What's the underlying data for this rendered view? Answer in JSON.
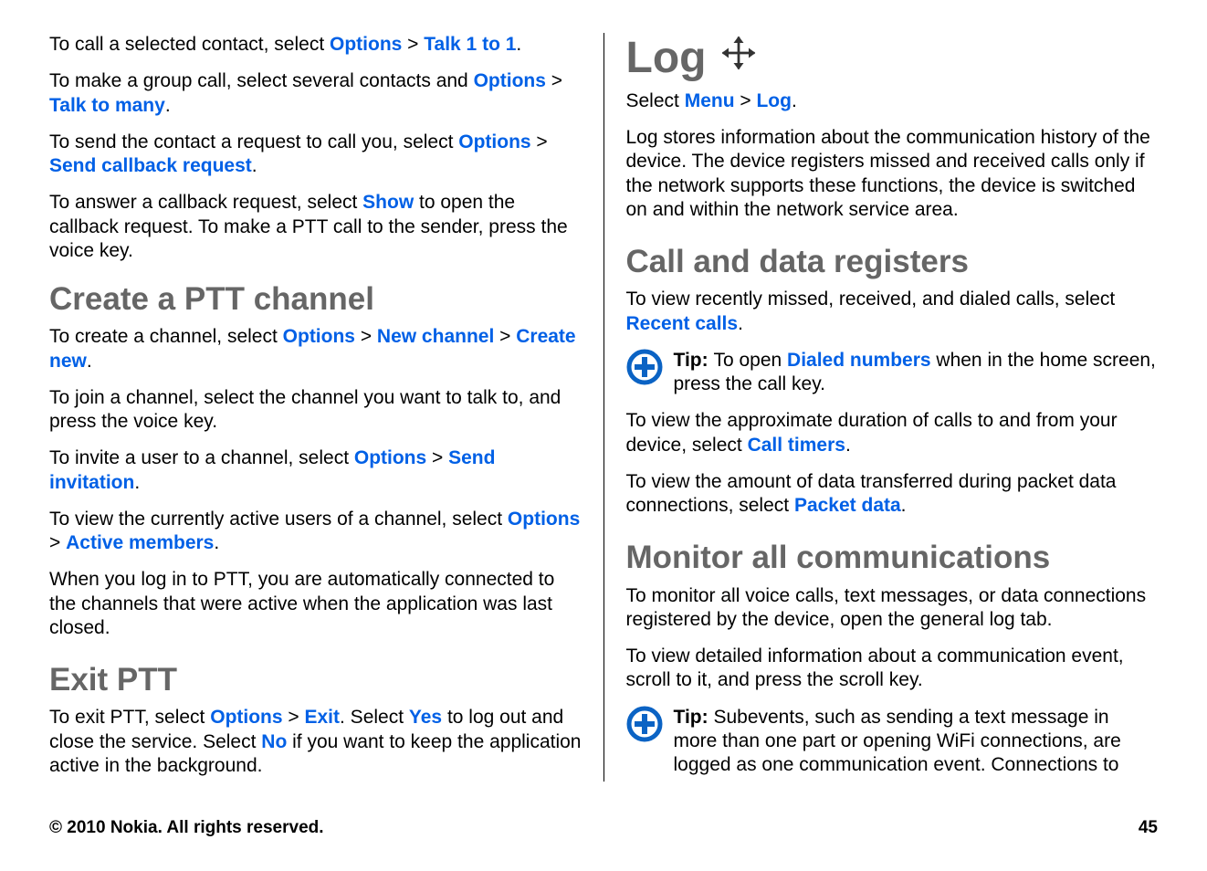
{
  "left": {
    "p1": {
      "t1": "To call a selected contact, select ",
      "options": "Options",
      "sep1": " > ",
      "talk1": "Talk 1 to 1",
      "end": "."
    },
    "p2": {
      "t1": "To make a group call, select several contacts and ",
      "options": "Options",
      "sep1": " > ",
      "talkmany": "Talk to many",
      "end": "."
    },
    "p3": {
      "t1": "To send the contact a request to call you, select ",
      "options": "Options",
      "sep1": " > ",
      "send": "Send callback request",
      "end": "."
    },
    "p4": {
      "t1": "To answer a callback request, select ",
      "show": "Show",
      "t2": " to open the callback request. To make a PTT call to the sender, press the voice key."
    },
    "h_create": "Create a PTT channel",
    "p5": {
      "t1": "To create a channel, select ",
      "options": "Options",
      "sep1": " > ",
      "newch": "New channel",
      "sep2": " > ",
      "create": "Create new",
      "end": "."
    },
    "p6": "To join a channel, select the channel you want to talk to, and press the voice key.",
    "p7": {
      "t1": "To invite a user to a channel, select ",
      "options": "Options",
      "sep1": " > ",
      "sendinv": "Send invitation",
      "end": "."
    },
    "p8": {
      "t1": "To view the currently active users of a channel, select ",
      "options": "Options",
      "sep1": " > ",
      "active": "Active members",
      "end": "."
    },
    "p9": "When you log in to PTT, you are automatically connected to the channels that were active when the application was last closed.",
    "h_exit": "Exit PTT",
    "p10": {
      "t1": "To exit PTT, select ",
      "options": "Options",
      "sep1": " > ",
      "exit": "Exit",
      "t2": ". Select ",
      "yes": "Yes",
      "t3": " to log out and close the service. Select ",
      "no": "No",
      "t4": " if you want to keep the application active in the background."
    }
  },
  "right": {
    "h_log": "Log",
    "p1": {
      "t1": "Select ",
      "menu": "Menu",
      "sep1": " > ",
      "log": "Log",
      "end": "."
    },
    "p2": "Log stores information about the communication history of the device. The device registers missed and received calls only if the network supports these functions, the device is switched on and within the network service area.",
    "h_call": "Call and data registers",
    "p3": {
      "t1": "To view recently missed, received, and dialed calls, select ",
      "recent": "Recent calls",
      "end": "."
    },
    "tip1": {
      "label": "Tip: ",
      "t1": "To open ",
      "dialed": "Dialed numbers",
      "t2": " when in the home screen, press the call key."
    },
    "p4": {
      "t1": "To view the approximate duration of calls to and from your device, select ",
      "timers": "Call timers",
      "end": "."
    },
    "p5": {
      "t1": "To view the amount of data transferred during packet data connections, select ",
      "packet": "Packet data",
      "end": "."
    },
    "h_monitor": "Monitor all communications",
    "p6": "To monitor all voice calls, text messages, or data connections registered by the device, open the general log tab.",
    "p7": "To view detailed information about a communication event, scroll to it, and press the scroll key.",
    "tip2": {
      "label": "Tip: ",
      "t1": "Subevents, such as sending a text message in more than one part or opening WiFi connections, are logged as one communication event. Connections to"
    }
  },
  "footer": {
    "copyright": "© 2010 Nokia. All rights reserved.",
    "page": "45"
  }
}
